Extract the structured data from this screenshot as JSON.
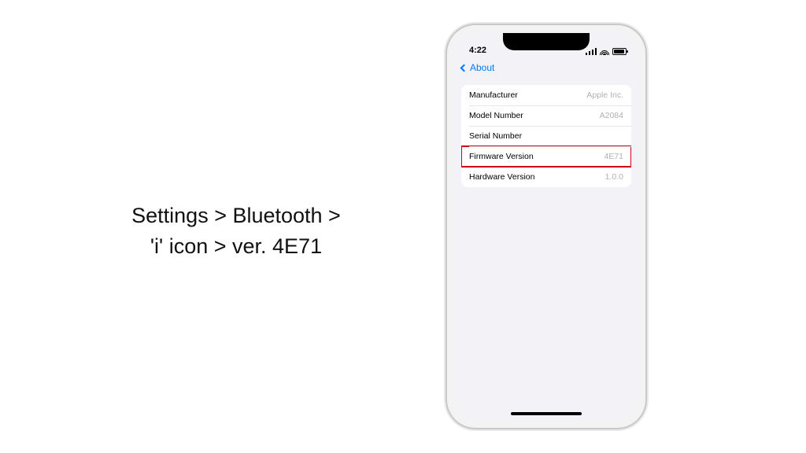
{
  "instruction": {
    "line1": "Settings > Bluetooth >",
    "line2": "'i' icon > ver. 4E71"
  },
  "status": {
    "time": "4:22"
  },
  "nav": {
    "back_label": "About"
  },
  "rows": [
    {
      "label": "Manufacturer",
      "value": "Apple Inc."
    },
    {
      "label": "Model Number",
      "value": "A2084"
    },
    {
      "label": "Serial Number",
      "value": ""
    },
    {
      "label": "Firmware Version",
      "value": "4E71"
    },
    {
      "label": "Hardware Version",
      "value": "1.0.0"
    }
  ],
  "highlight_index": 3
}
